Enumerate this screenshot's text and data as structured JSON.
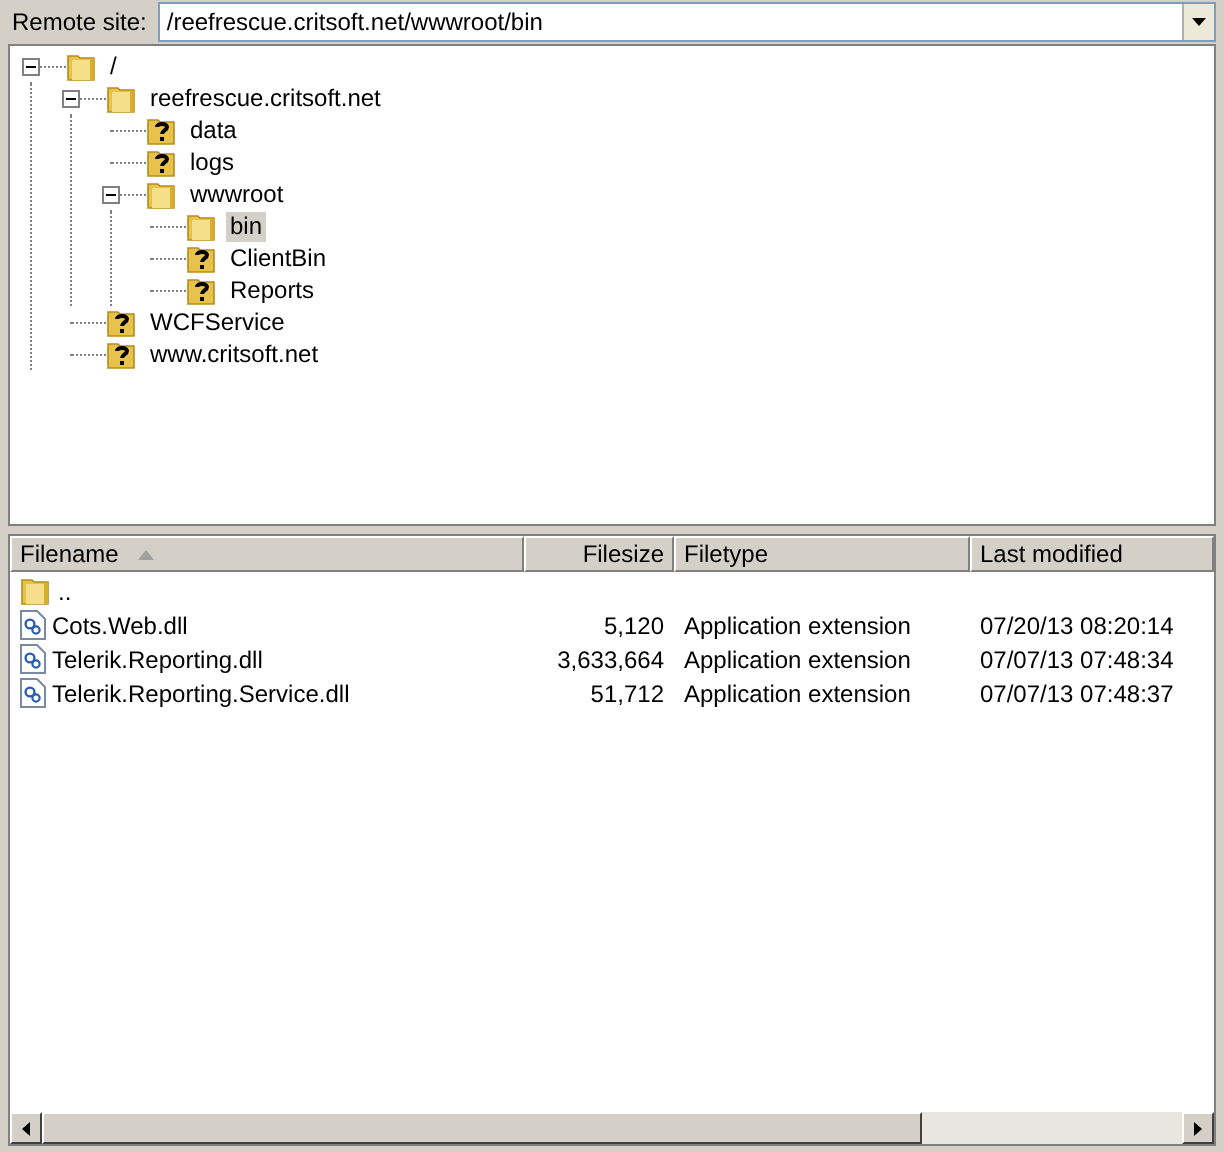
{
  "remote_site": {
    "label": "Remote site:",
    "path": "/reefrescue.critsoft.net/wwwroot/bin"
  },
  "tree": [
    {
      "label": "/",
      "kind": "folder",
      "expanded": true,
      "selected": false,
      "children": [
        {
          "label": "reefrescue.critsoft.net",
          "kind": "folder",
          "expanded": true,
          "selected": false,
          "children": [
            {
              "label": "data",
              "kind": "unknown",
              "selected": false
            },
            {
              "label": "logs",
              "kind": "unknown",
              "selected": false
            },
            {
              "label": "wwwroot",
              "kind": "folder",
              "expanded": true,
              "selected": false,
              "children": [
                {
                  "label": "bin",
                  "kind": "folder",
                  "selected": true
                },
                {
                  "label": "ClientBin",
                  "kind": "unknown",
                  "selected": false
                },
                {
                  "label": "Reports",
                  "kind": "unknown",
                  "selected": false
                }
              ]
            }
          ]
        },
        {
          "label": "WCFService",
          "kind": "unknown",
          "selected": false
        },
        {
          "label": "www.critsoft.net",
          "kind": "unknown",
          "selected": false
        }
      ]
    }
  ],
  "file_list": {
    "columns": [
      {
        "label": "Filename",
        "sorted": true
      },
      {
        "label": "Filesize",
        "sorted": false
      },
      {
        "label": "Filetype",
        "sorted": false
      },
      {
        "label": "Last modified",
        "sorted": false
      }
    ],
    "rows": [
      {
        "kind": "parent",
        "filename": ".."
      },
      {
        "kind": "file",
        "filename": "Cots.Web.dll",
        "filesize": "5,120",
        "filetype": "Application extension",
        "last_modified": "07/20/13 08:20:14"
      },
      {
        "kind": "file",
        "filename": "Telerik.Reporting.dll",
        "filesize": "3,633,664",
        "filetype": "Application extension",
        "last_modified": "07/07/13 07:48:34"
      },
      {
        "kind": "file",
        "filename": "Telerik.Reporting.Service.dll",
        "filesize": "51,712",
        "filetype": "Application extension",
        "last_modified": "07/07/13 07:48:37"
      }
    ]
  }
}
